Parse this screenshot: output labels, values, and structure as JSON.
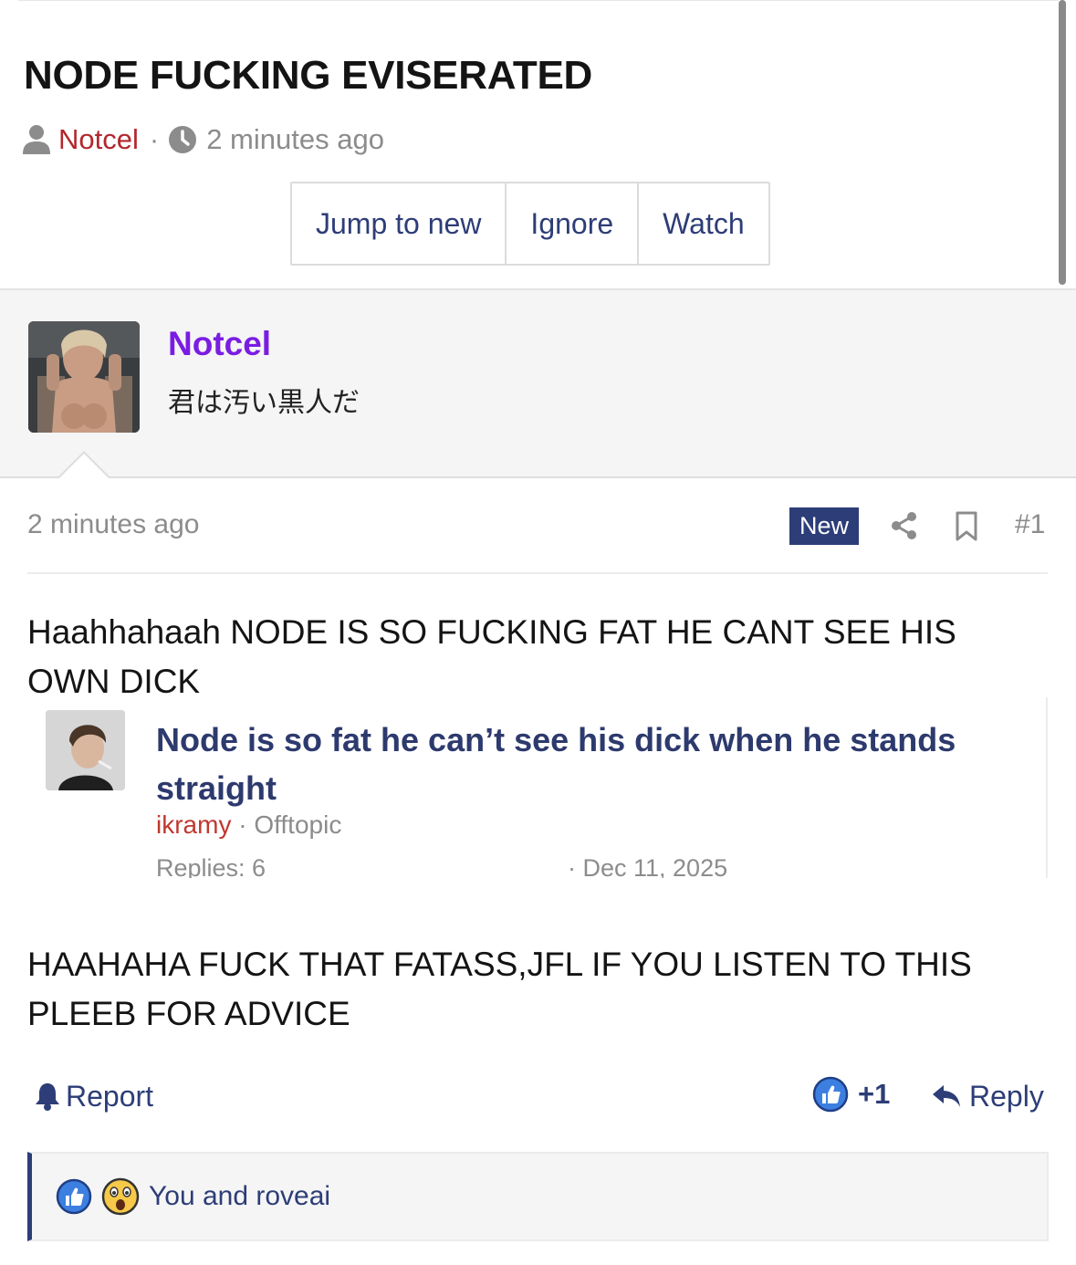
{
  "thread": {
    "title": "NODE FUCKING EVISERATED",
    "author": "Notcel",
    "separator": "·",
    "time": "2 minutes ago",
    "actions": [
      "Jump to new",
      "Ignore",
      "Watch"
    ]
  },
  "post": {
    "username": "Notcel",
    "user_title": "君は汚い黒人だ",
    "time": "2 minutes ago",
    "badge": "New",
    "number": "#1",
    "body_1": "Haahhahaah NODE IS SO FUCKING FAT HE CANT SEE HIS OWN DICK",
    "body_2": "HAAHAHA FUCK THAT FATASS,JFL IF YOU LISTEN TO THIS PLEEB FOR ADVICE",
    "report_label": "Report",
    "like_count": "+1",
    "reply_label": "Reply",
    "reactions_text": "You and roveai",
    "icons": [
      "share-icon",
      "bookmark-icon",
      "bell-icon",
      "like-icon",
      "reply-icon",
      "wow-icon"
    ]
  },
  "embed": {
    "title": "Node is so fat he can’t see his dick when he stands straight",
    "author": "ikramy",
    "forum": "Offtopic",
    "replies": "Replies: 6",
    "date": "· Dec 11, 2025"
  },
  "colors": {
    "accent": "#2c3d78",
    "link": "#2d3d77",
    "author_red": "#b3272d",
    "username_purple": "#7a1de3",
    "muted": "#8c8c8c"
  }
}
